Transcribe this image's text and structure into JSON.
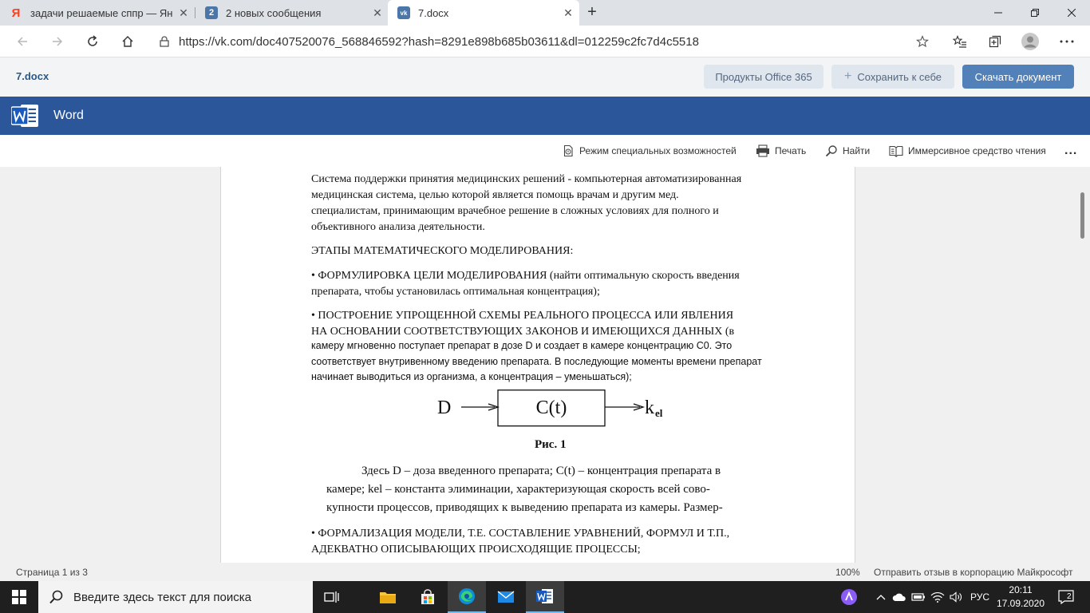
{
  "browser": {
    "tabs": [
      {
        "title": "задачи решаемые сппр — Янде",
        "favicon": "yandex-icon"
      },
      {
        "title": "2 новых сообщения",
        "favicon": "vk-count-icon",
        "badge": "2"
      },
      {
        "title": "7.docx",
        "favicon": "vk-icon"
      }
    ],
    "url": "https://vk.com/doc407520076_568846592?hash=8291e898b685b03611&dl=012259c2fc7d4c5518"
  },
  "vk": {
    "doc_name": "7.docx",
    "office_label": "Продукты Office 365",
    "save_label": "Сохранить к себе",
    "download_label": "Скачать документ",
    "colors": {
      "link": "#2a5885",
      "primary": "#5181b8",
      "secondary": "#dfe6ee"
    }
  },
  "word": {
    "app_name": "Word",
    "brand_color": "#2b579a",
    "toolbar": {
      "accessibility": "Режим специальных возможностей",
      "print": "Печать",
      "find": "Найти",
      "immersive": "Иммерсивное средство чтения",
      "more": "..."
    }
  },
  "document": {
    "p1": [
      "Система поддержки принятия медицинских решений - компьютерная автоматизированная",
      "медицинская система, целью которой является помощь врачам и другим мед.",
      "специалистам, принимающим врачебное решение в сложных условиях для полного и",
      "объективного анализа деятельности."
    ],
    "heading": "ЭТАПЫ МАТЕМАТИЧЕСКОГО МОДЕЛИРОВАНИЯ:",
    "b1": [
      "• ФОРМУЛИРОВКА ЦЕЛИ МОДЕЛИРОВАНИЯ (найти оптимальную скорость введения",
      "препарата, чтобы установилась оптимальная концентрация);"
    ],
    "b2": [
      "• ПОСТРОЕНИЕ УПРОЩЕННОЙ СХЕМЫ РЕАЛЬНОГО ПРОЦЕССА ИЛИ ЯВЛЕНИЯ",
      "НА ОСНОВАНИИ СООТВЕТСТВУЮЩИХ ЗАКОНОВ И ИМЕЮЩИХСЯ ДАННЫХ (в"
    ],
    "b2_detail": [
      "камеру мгновенно поступает препарат в дозе D и создает в камере концентрацию С0. Это",
      "соответствует внутривенному введению препарата. В последующие моменты времени препарат",
      "начинает выводиться из организма, а концентрация – уменьшаться);"
    ],
    "figure": {
      "input": "D",
      "box": "C(t)",
      "output": "k",
      "output_sub": "el",
      "caption": "Рис. 1"
    },
    "fig_text": [
      "Здесь D – доза введенного препарата; C(t) – концентрация препарата в",
      "камере; kel – константа элиминации, характеризующая скорость всей сово-",
      "купности процессов, приводящих к выведению препарата из камеры. Размер-"
    ],
    "b3": [
      "• ФОРМАЛИЗАЦИЯ МОДЕЛИ, Т.Е. СОСТАВЛЕНИЕ УРАВНЕНИЙ, ФОРМУЛ И Т.П.,",
      "АДЕКВАТНО ОПИСЫВАЮЩИХ ПРОИСХОДЯЩИЕ ПРОЦЕССЫ;"
    ]
  },
  "status": {
    "page": "Страница 1 из 3",
    "zoom": "100%",
    "feedback": "Отправить отзыв в корпорацию Майкрософт"
  },
  "taskbar": {
    "search_placeholder": "Введите здесь текст для поиска",
    "lang": "РУС",
    "time": "20:11",
    "date": "17.09.2020",
    "notifications": "2"
  }
}
